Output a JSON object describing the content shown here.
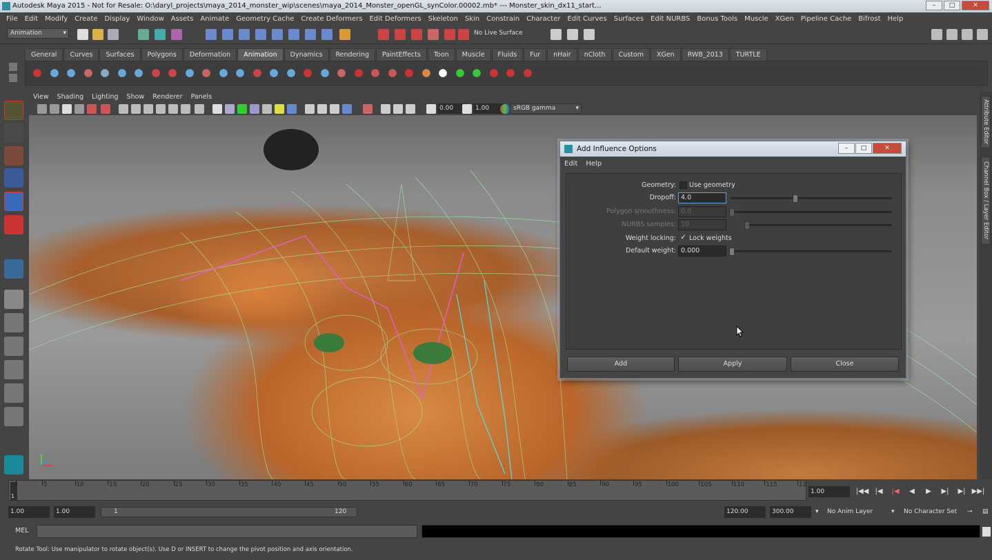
{
  "window": {
    "title": "Autodesk Maya 2015 - Not for Resale: O:\\daryl_projects\\maya_2014_monster_wip\\scenes\\maya_2014_Monster_openGL_synColor.00002.mb*   ---   Monster_skin_dx11_start..."
  },
  "menubar": [
    "File",
    "Edit",
    "Modify",
    "Create",
    "Display",
    "Window",
    "Assets",
    "Animate",
    "Geometry Cache",
    "Create Deformers",
    "Edit Deformers",
    "Skeleton",
    "Skin",
    "Constrain",
    "Character",
    "Edit Curves",
    "Surfaces",
    "Edit NURBS",
    "Bonus Tools",
    "Muscle",
    "XGen",
    "Pipeline Cache",
    "Bifrost",
    "Help"
  ],
  "statusline": {
    "mode": "Animation",
    "live_surface": "No Live Surface"
  },
  "shelf_tabs": {
    "items": [
      "General",
      "Curves",
      "Surfaces",
      "Polygons",
      "Deformation",
      "Animation",
      "Dynamics",
      "Rendering",
      "PaintEffects",
      "Toon",
      "Muscle",
      "Fluids",
      "Fur",
      "nHair",
      "nCloth",
      "Custom",
      "XGen",
      "RWB_2013",
      "TURTLE"
    ],
    "active": "Animation"
  },
  "viewport": {
    "menu": [
      "View",
      "Shading",
      "Lighting",
      "Show",
      "Renderer",
      "Panels"
    ],
    "field1": "0.00",
    "field2": "1.00",
    "color_space": "sRGB gamma"
  },
  "side_tabs": [
    "Attribute Editor",
    "Channel Box / Layer Editor"
  ],
  "dialog": {
    "title": "Add Influence Options",
    "menu": [
      "Edit",
      "Help"
    ],
    "geometry_label": "Geometry:",
    "use_geometry_label": "Use geometry",
    "use_geometry_checked": false,
    "dropoff_label": "Dropoff:",
    "dropoff_value": "4.0",
    "dropoff_slider_level": 0.4,
    "polygon_smoothness_label": "Polygon smoothness:",
    "polygon_smoothness_value": "0.0",
    "nurbs_samples_label": "NURBS samples:",
    "nurbs_samples_value": "10",
    "weight_locking_label": "Weight locking:",
    "lock_weights_label": "Lock weights",
    "lock_weights_checked": true,
    "default_weight_label": "Default weight:",
    "default_weight_value": "0.000",
    "buttons": {
      "add": "Add",
      "apply": "Apply",
      "close": "Close"
    }
  },
  "timeline": {
    "ticks": [
      "1",
      "5",
      "10",
      "15",
      "20",
      "25",
      "30",
      "35",
      "40",
      "45",
      "50",
      "55",
      "60",
      "65",
      "70",
      "75",
      "80",
      "85",
      "90",
      "95",
      "100",
      "105",
      "110",
      "115",
      "12"
    ],
    "current_frame": "1",
    "frame_field": "1.00"
  },
  "range": {
    "start_time": "1.00",
    "playback_start": "1.00",
    "range_start_label": "1",
    "range_end_label": "120",
    "playback_end": "120.00",
    "end_time": "300.00",
    "anim_layer": "No Anim Layer",
    "character_set": "No Character Set"
  },
  "command_line": {
    "label": "MEL",
    "value": ""
  },
  "help_line": "Rotate Tool: Use manipulator to rotate object(s). Use D or INSERT to change the pivot position and axis orientation."
}
